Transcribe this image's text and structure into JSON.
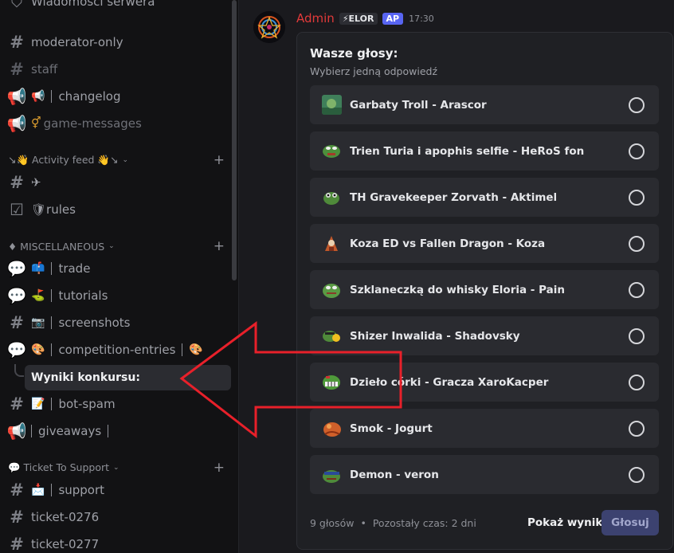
{
  "sidebar": {
    "top_partial": "Wiadomości serwera",
    "channels": [
      {
        "label": "moderator-only",
        "muted": false
      },
      {
        "label": "staff",
        "muted": true
      },
      {
        "label": "changelog",
        "emoji": "📢"
      },
      {
        "label": "game-messages",
        "emoji": "⚥",
        "muted": true
      }
    ],
    "categories": {
      "activity": "↘👋 Activity feed 👋↘",
      "misc": "♦ MISCELLANEOUS",
      "ticket": "💬 Ticket To Support"
    },
    "activity_channels": [
      {
        "label": "✈"
      },
      {
        "label": "🛡rules"
      }
    ],
    "misc_channels": [
      {
        "label": "trade",
        "emoji": "📫"
      },
      {
        "label": "tutorials",
        "emoji": "⛳"
      },
      {
        "label": "screenshots",
        "emoji": "📷"
      },
      {
        "label": "competition-entries",
        "emoji": "🎨",
        "trail_emoji": "🎨"
      },
      {
        "label": "bot-spam",
        "emoji": "📝"
      },
      {
        "label": "giveaways"
      }
    ],
    "thread": "Wyniki konkursu:",
    "ticket_channels": [
      {
        "label": "support",
        "emoji": "📩"
      },
      {
        "label": "ticket-0276"
      },
      {
        "label": "ticket-0277"
      }
    ]
  },
  "message": {
    "username": "Admin",
    "badge1": "⚡ELOR",
    "badge2": "AP",
    "time": "17:30"
  },
  "poll": {
    "title": "Wasze głosy:",
    "subtitle": "Wybierz jedną odpowiedź",
    "options": [
      "Garbaty Troll - Arascor",
      "Trien Turia i apophis selfie - HeRoS fon",
      "TH Gravekeeper Zorvath - Aktimel",
      "Koza ED vs Fallen Dragon - Koza",
      "Szklaneczką do whisky Eloria - Pain",
      "Shizer Inwalida - Shadovsky",
      "Dzieło córki - Gracza XaroKacper",
      "Smok - Jogurt",
      "Demon - veron"
    ],
    "votes": "9 głosów",
    "dot": "•",
    "time_left": "Pozostały czas: 2 dni",
    "show_results": "Pokaż wyniki",
    "vote_button": "Głosuj"
  },
  "colors": {
    "username": "#e23a3a",
    "accent": "#5865f2",
    "arrow": "#e8202a"
  }
}
